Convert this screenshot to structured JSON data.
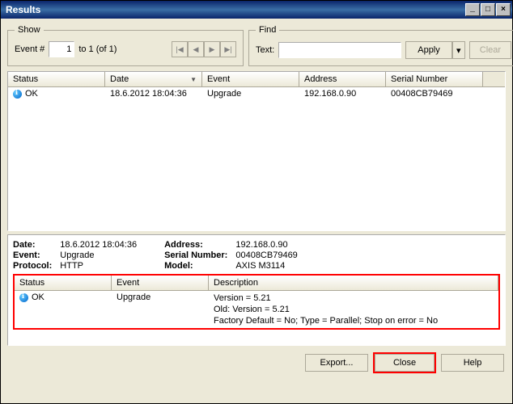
{
  "window": {
    "title": "Results"
  },
  "show": {
    "legend": "Show",
    "label_prefix": "Event #",
    "value": "1",
    "range": "to 1 (of 1)"
  },
  "find": {
    "legend": "Find",
    "label": "Text:",
    "value": "",
    "apply": "Apply",
    "clear": "Clear"
  },
  "table": {
    "headers": {
      "status": "Status",
      "date": "Date",
      "event": "Event",
      "address": "Address",
      "serial": "Serial Number"
    },
    "rows": [
      {
        "status": "OK",
        "date": "18.6.2012 18:04:36",
        "event": "Upgrade",
        "address": "192.168.0.90",
        "serial": "00408CB79469"
      }
    ]
  },
  "details": {
    "labels": {
      "date": "Date:",
      "event": "Event:",
      "protocol": "Protocol:",
      "address": "Address:",
      "serial": "Serial Number:",
      "model": "Model:"
    },
    "values": {
      "date": "18.6.2012 18:04:36",
      "event": "Upgrade",
      "protocol": "HTTP",
      "address": "192.168.0.90",
      "serial": "00408CB79469",
      "model": "AXIS M3114"
    },
    "table": {
      "headers": {
        "status": "Status",
        "event": "Event",
        "description": "Description"
      },
      "row": {
        "status": "OK",
        "event": "Upgrade",
        "desc_line1": "Version = 5.21",
        "desc_line2": "Old: Version = 5.21",
        "desc_line3": "Factory Default = No; Type = Parallel; Stop on error = No"
      }
    }
  },
  "buttons": {
    "export": "Export...",
    "close": "Close",
    "help": "Help"
  }
}
